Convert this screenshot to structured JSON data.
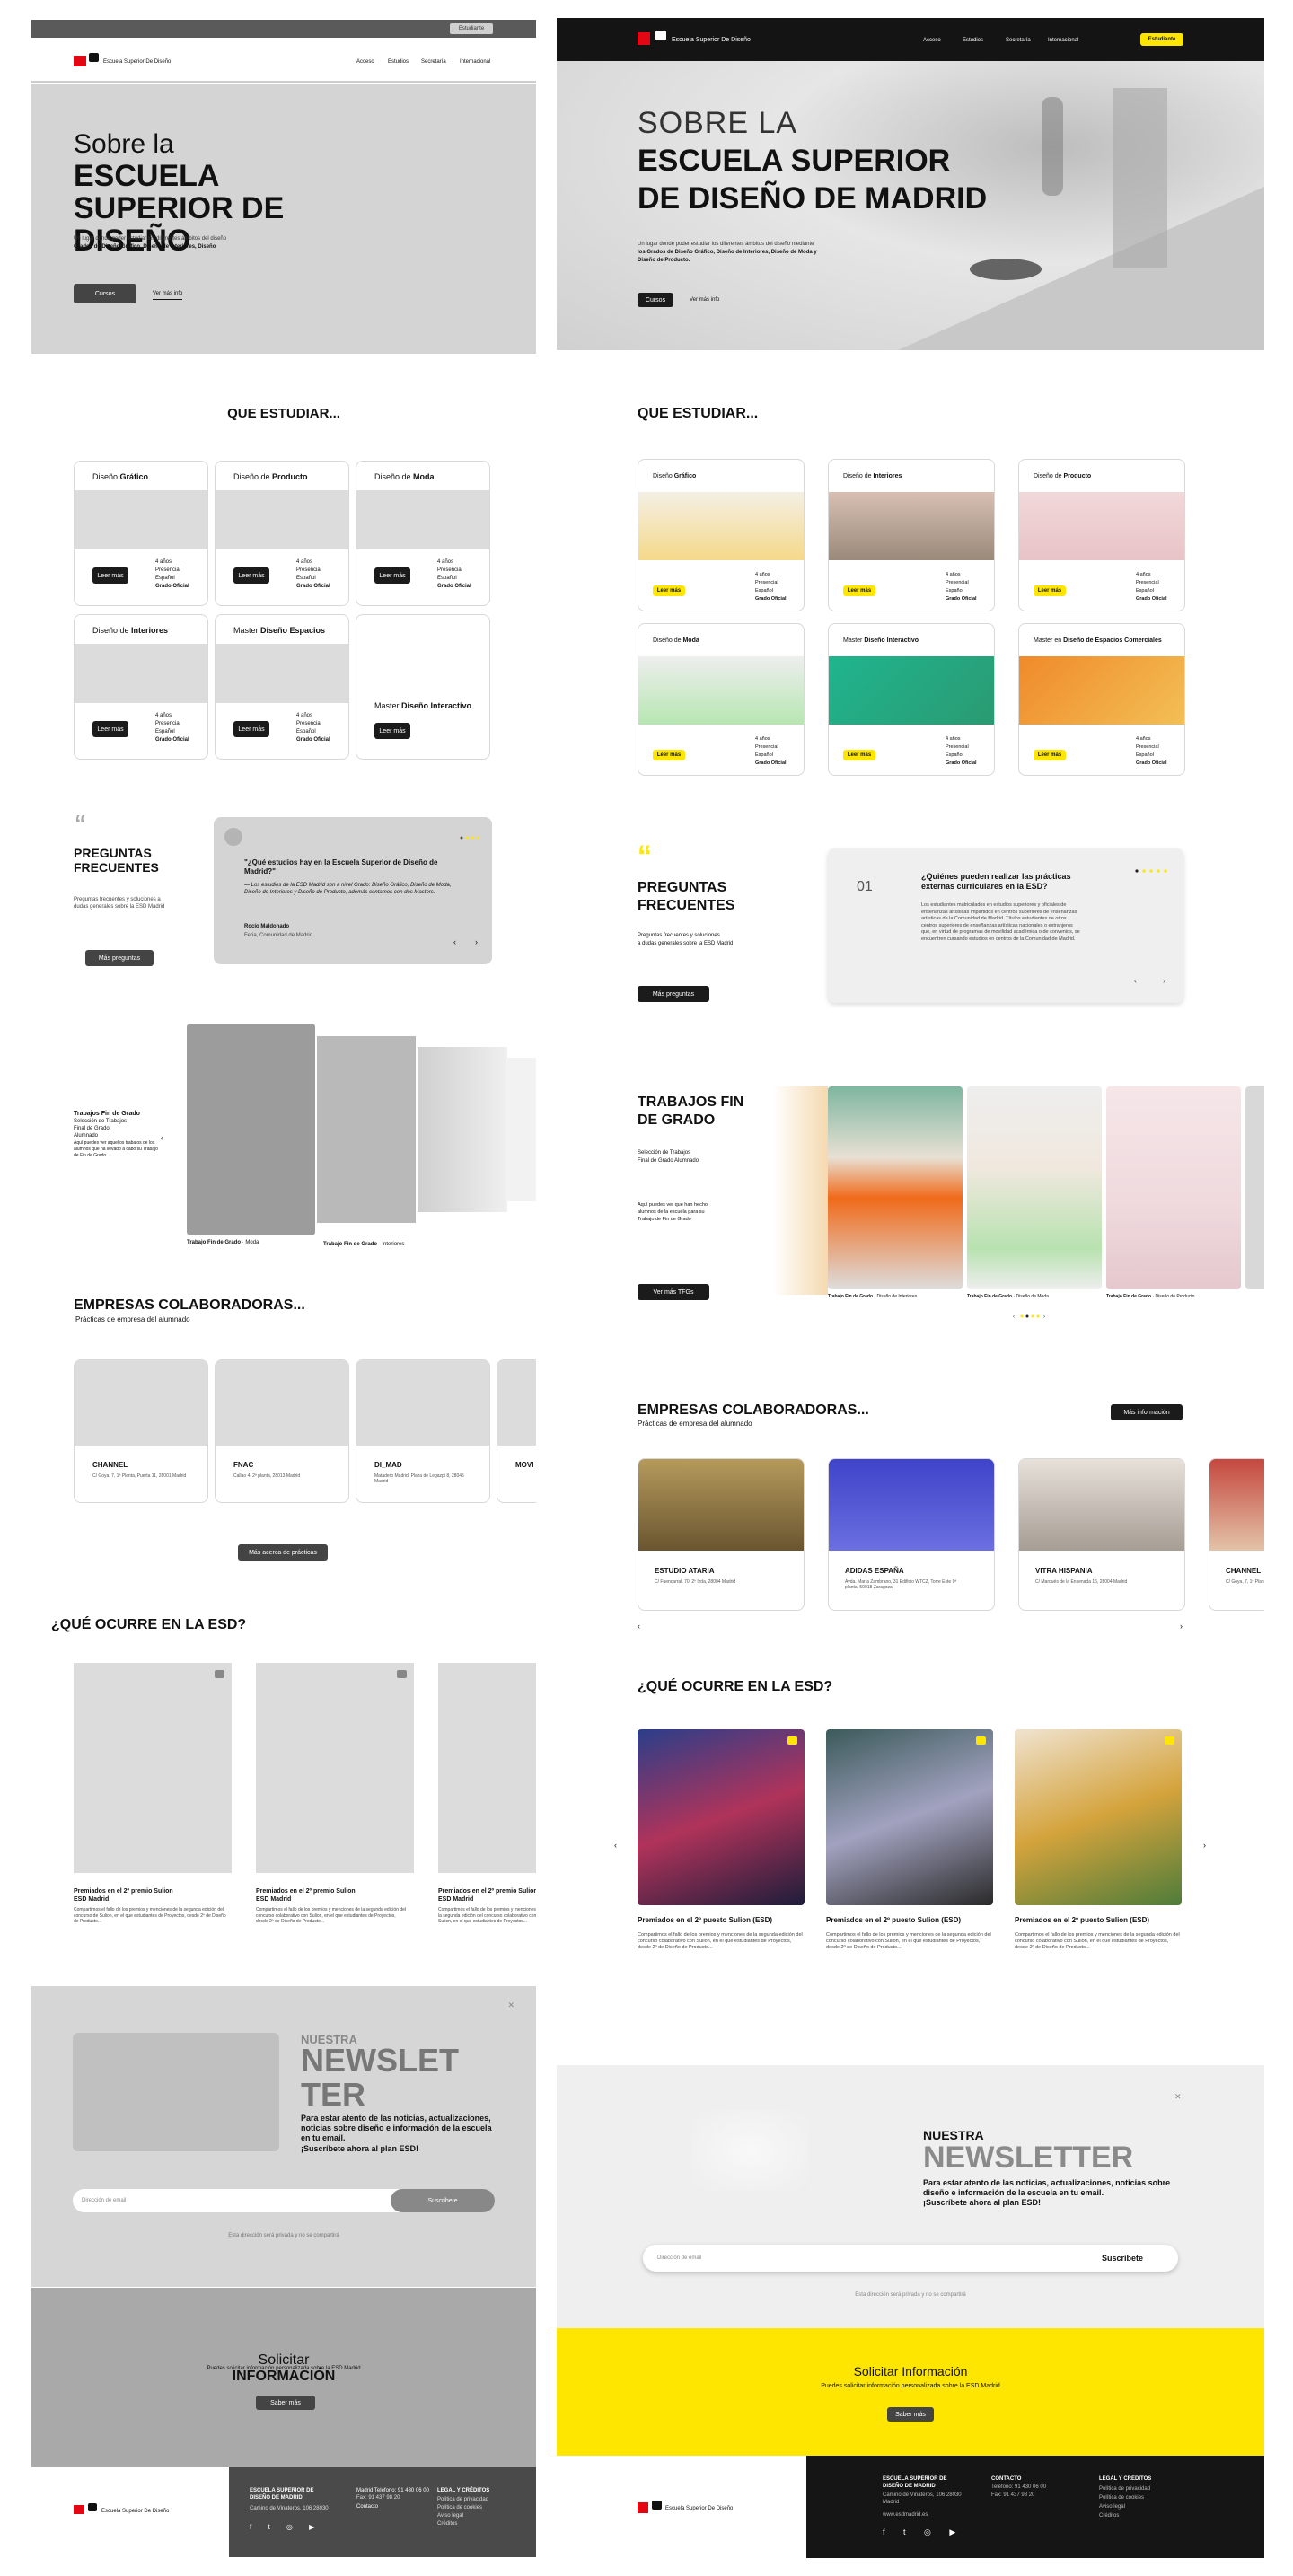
{
  "brand": {
    "name": "Escuela Superior De Diseño",
    "logo_text": "esd"
  },
  "nav": [
    "Acceso",
    "Estudios",
    "Secretaría",
    "Internacional"
  ],
  "nav_pill": "Estudiante",
  "wire_topbar_pill": "Estudiante",
  "hero_wire": {
    "l1": "Sobre la",
    "l2": "ESCUELA",
    "l3": "SUPERIOR DE",
    "l4": "DISEÑO",
    "body": "Un lugar donde poder estudiar los diferentes ámbitos del diseño",
    "body_bold": "Grados de Diseño Gráfico, Diseño de Interiores, Diseño",
    "cta": "Cursos",
    "link": "Ver más info"
  },
  "hero": {
    "l1": "SOBRE LA",
    "l2": "ESCUELA SUPERIOR",
    "l3": "DE DISEÑO DE MADRID",
    "body": "Un lugar donde poder estudiar los diferentes ámbitos del diseño mediante",
    "body_b1": "los Grados de Diseño Gráfico, Diseño de Interiores, Diseño de Moda y",
    "body_b2": "Diseño de Producto.",
    "cta": "Cursos",
    "link": "Ver más info"
  },
  "study": {
    "title_wire": "QUE ESTUDIAR...",
    "title": "QUE ESTUDIAR...",
    "btn": "Leer más",
    "meta": [
      "4 años",
      "Presencial",
      "Español",
      "Grado Oficial"
    ],
    "wire_cards": [
      {
        "pre": "Diseño ",
        "b": "Gráfico"
      },
      {
        "pre": "Diseño de ",
        "b": "Producto"
      },
      {
        "pre": "Diseño de ",
        "b": "Moda"
      },
      {
        "pre": "Diseño de ",
        "b": "Interiores"
      },
      {
        "pre": "Master ",
        "b": "Diseño Espacios"
      },
      {
        "pre": "Master ",
        "b": "Diseño Interactivo"
      }
    ],
    "cards": [
      {
        "pre": "Diseño ",
        "b": "Gráfico"
      },
      {
        "pre": "Diseño de ",
        "b": "Interiores"
      },
      {
        "pre": "Diseño de ",
        "b": "Producto"
      },
      {
        "pre": "Diseño de ",
        "b": "Moda"
      },
      {
        "pre": "Master ",
        "b": "Diseño Interactivo"
      },
      {
        "pre": "Master en ",
        "b": "Diseño de Espacios Comerciales"
      }
    ]
  },
  "faq_wire": {
    "title": "PREGUNTAS FRECUENTES",
    "sub": "Preguntas frecuentes y soluciones a dudas generales sobre la ESD Madrid",
    "btn": "Más preguntas",
    "q": "\"¿Qué estudios hay en la Escuela Superior de Diseño de Madrid?\"",
    "a": "— Los estudios de la ESD Madrid son a nivel Grado: Diseño Gráfico, Diseño de Moda, Diseño de Interiores y Diseño de Producto, además contamos con dos Masters.",
    "name": "Rocío Maldonado",
    "role": "Feria, Comunidad de Madrid"
  },
  "faq": {
    "title1": "PREGUNTAS",
    "title2": "FRECUENTES",
    "sub1": "Preguntas frecuentes y soluciones",
    "sub2": "a dudas generales sobre la ESD Madrid",
    "btn": "Más preguntas",
    "num": "01",
    "q1": "¿Quiénes pueden realizar las prácticas",
    "q2": "externas curriculares en la ESD?",
    "a": "Los estudiantes matriculados en estudios superiores y oficiales de enseñanzas artísticas impartidos en centros superiores de enseñanzas artísticas de la Comunidad de Madrid. Títulos estudiantes de otros centros superiores de enseñanzas artísticas nacionales o extranjeros que, en virtud de programas de movilidad académica o de convenios, se encuentren cursando estudios en centros de la Comunidad de Madrid."
  },
  "tfg_wire": {
    "title": "Trabajos Fin de Grado",
    "sub": "Selección de Trabajos Final de Grado Alumnado",
    "body": "Aquí puedes ver aquellos trabajos de los alumnos que ha llevado a cabo su Trabajo de Fin de Grado",
    "cap1": "Trabajo Fin de Grado",
    "cap1b": "Moda",
    "cap2": "Trabajo Fin de Grado",
    "cap2b": "Interiores"
  },
  "tfg": {
    "t1": "TRABAJOS FIN",
    "t2": "DE GRADO",
    "sub1": "Selección de Trabajos",
    "sub2": "Final de Grado Alumnado",
    "body": "Aquí puedes ver que han hecho alumnos de la escuela para su Trabajo de Fin de Grado",
    "btn": "Ver más TFGs",
    "caps": [
      {
        "b": "Trabajo Fin de Grado",
        "t": "Diseño de Interiores"
      },
      {
        "b": "Trabajo Fin de Grado",
        "t": "Diseño de Moda"
      },
      {
        "b": "Trabajo Fin de Grado",
        "t": "Diseño de Producto"
      }
    ]
  },
  "companies_wire": {
    "title": "EMPRESAS COLABORADORAS...",
    "sub": "Prácticas de empresa del alumnado",
    "btn": "Más acerca de prácticas",
    "items": [
      {
        "n": "CHANNEL",
        "a": "C/ Goya, 7, 1ª Planta, Puerta 11, 28001 Madrid"
      },
      {
        "n": "FNAC",
        "a": "Callao 4, 2ª planta, 28013 Madrid"
      },
      {
        "n": "DI_MAD",
        "a": "Matadero Madrid, Plaza de Legazpi 8, 28045 Madrid"
      },
      {
        "n": "MOVI",
        "a": ""
      }
    ]
  },
  "companies": {
    "title": "EMPRESAS COLABORADORAS...",
    "sub": "Prácticas de empresa del alumnado",
    "btn": "Más información",
    "items": [
      {
        "n": "ESTUDIO ATARIA",
        "a": "C/ Fuencarral, 70, 2º Izda, 28004 Madrid"
      },
      {
        "n": "ADIDAS ESPAÑA",
        "a": "Avda. María Zambrano, 31 Edificio WTCZ, Torre Este 9ª planta, 50018 Zaragoza"
      },
      {
        "n": "VITRA HISPANIA",
        "a": "C/ Marqués de la Ensenada 16, 28004 Madrid"
      },
      {
        "n": "CHANNEL",
        "a": "C/ Goya, 7, 1ª Planta, Puerta 11"
      }
    ]
  },
  "news_wire": {
    "title": "¿QUÉ OCURRE EN LA ESD?",
    "items": [
      {
        "t": "Premiados en el 2º premio Sulion ESD Madrid",
        "d": "Compartimos el fallo de los premios y menciones de la segunda edición del concurso de Sulion, en el que estudiantes de Proyectos, desde 2º de Diseño de Producto..."
      },
      {
        "t": "Premiados en el 2º premio Sulion ESD Madrid",
        "d": "Compartimos el fallo de los premios y menciones de la segunda edición del concurso colaborativo con Sulion, en el que estudiantes de Proyectos, desde 2º de Diseño de Producto..."
      },
      {
        "t": "Premiados en el 2º premio Sulion ESD Madrid",
        "d": "Compartimos el fallo de los premios y menciones de la segunda edición del concurso colaborativo con Sulion, en el que estudiantes de Proyectos..."
      }
    ]
  },
  "news": {
    "title": "¿QUÉ OCURRE EN LA ESD?",
    "items": [
      {
        "t": "Premiados en el 2º puesto Sulion (ESD)",
        "d": "Compartimos el fallo de los premios y menciones de la segunda edición del concurso colaborativo con Sulion, en el que estudiantes de Proyectos, desde 2º de Diseño de Producto..."
      },
      {
        "t": "Premiados en el 2º puesto Sulion (ESD)",
        "d": "Compartimos el fallo de los premios y menciones de la segunda edición del concurso colaborativo con Sulion, en el que estudiantes de Proyectos, desde 2º de Diseño de Producto..."
      },
      {
        "t": "Premiados en el 2º puesto Sulion (ESD)",
        "d": "Compartimos el fallo de los premios y menciones de la segunda edición del concurso colaborativo con Sulion, en el que estudiantes de Proyectos, desde 2º de Diseño de Producto..."
      }
    ]
  },
  "newsletter_wire": {
    "l1": "NUESTRA",
    "l2": "NEWSLET",
    "l3": "TER",
    "body": "Para estar atento de las noticias, actualizaciones, noticias sobre diseño e información de la escuela en tu email.",
    "cta": "¡Suscríbete ahora al plan ESD!",
    "ph": "Dirección de email",
    "btn": "Suscribete",
    "note": "Esta dirección será privada y no se compartirá"
  },
  "newsletter": {
    "l1": "NUESTRA",
    "l2": "NEWSLETTER",
    "body1": "Para estar atento de las noticias, actualizaciones, noticias sobre",
    "body2": "diseño e información de la escuela en tu email.",
    "cta": "¡Suscríbete ahora al plan ESD!",
    "ph": "Dirección de email",
    "btn": "Suscribete",
    "note": "Esta dirección será privada y no se compartirá"
  },
  "info_wire": {
    "t1": "Solicitar",
    "t2": "INFORMACIÓN",
    "body": "Puedes solicitar información personalizada sobre la ESD Madrid",
    "btn": "Saber más"
  },
  "info": {
    "title": "Solicitar Información",
    "body": "Puedes solicitar información personalizada sobre la ESD Madrid",
    "btn": "Saber más"
  },
  "footer": {
    "school": "ESCUELA SUPERIOR DE DISEÑO DE MADRID",
    "addr": "Camino de Vinateros, 106 28030 Madrid",
    "web": "www.esdmadrid.es",
    "contact": "CONTACTO",
    "phone": "Teléfono: 91 430 06 00",
    "phone2": "Fax: 91 437 98 20",
    "legal": "LEGAL Y CRÉDITOS",
    "links": [
      "Política de privacidad",
      "Política de cookies",
      "Aviso legal",
      "Créditos"
    ]
  },
  "footer_wire": {
    "school": "ESCUELA SUPERIOR DE DISEÑO DE MADRID",
    "addr": "Camino de Vinateros, 106 28030",
    "phone": "Madrid Teléfono: 91 430 06 00",
    "fax": "Fax: 91 437 98 20",
    "email": "Contacto",
    "legal": "LEGAL Y CRÉDITOS",
    "links": [
      "Política de privacidad",
      "Política de cookies",
      "Aviso legal",
      "Créditos"
    ]
  },
  "colors": {
    "accent": "#ffe600",
    "dark": "#151515",
    "brand_red": "#e30613"
  }
}
